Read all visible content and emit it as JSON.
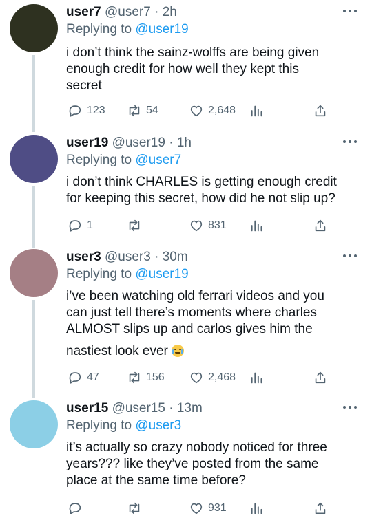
{
  "colors": {
    "accent": "#1d9bf0",
    "muted": "#536471",
    "thread_line": "#cfd9de"
  },
  "tweets": [
    {
      "name": "user7",
      "handle": "@user7",
      "time": "· 2h",
      "reply_prefix": "Replying to",
      "reply_mention": "@user19",
      "text_lines": [
        "i don’t think the sainz-wolffs are being given",
        "enough credit for how well they kept this",
        "secret"
      ],
      "replies": "123",
      "retweets": "54",
      "likes": "2,648",
      "avatar_color": "#2e3120"
    },
    {
      "name": "user19",
      "handle": "@user19",
      "time": "· 1h",
      "reply_prefix": "Replying to",
      "reply_mention": "@user7",
      "text_lines": [
        "i don’t think CHARLES is getting enough credit",
        "for keeping this secret, how did he not slip up?"
      ],
      "replies": "1",
      "retweets": "",
      "likes": "831",
      "avatar_color": "#4f4d85"
    },
    {
      "name": "user3",
      "handle": "@user3",
      "time": "· 30m",
      "reply_prefix": "Replying to",
      "reply_mention": "@user19",
      "text_lines": [
        "i’ve been watching old ferrari videos and you",
        "can just tell there’s moments where charles",
        "ALMOST slips up and carlos gives him the",
        "nastiest look ever"
      ],
      "emoji": "loudly-crying-face",
      "replies": "47",
      "retweets": "156",
      "likes": "2,468",
      "avatar_color": "#a57f85"
    },
    {
      "name": "user15",
      "handle": "@user15",
      "time": "· 13m",
      "reply_prefix": "Replying to",
      "reply_mention": "@user3",
      "text_lines": [
        "it’s actually so crazy nobody noticed for three",
        "years??? like they’ve posted from the same",
        "place at the same time before?"
      ],
      "replies": "",
      "retweets": "",
      "likes": "931",
      "avatar_color": "#8ccfe6"
    }
  ],
  "icons": [
    "reply-icon",
    "retweet-icon",
    "like-icon",
    "views-icon",
    "share-icon",
    "more-icon"
  ]
}
